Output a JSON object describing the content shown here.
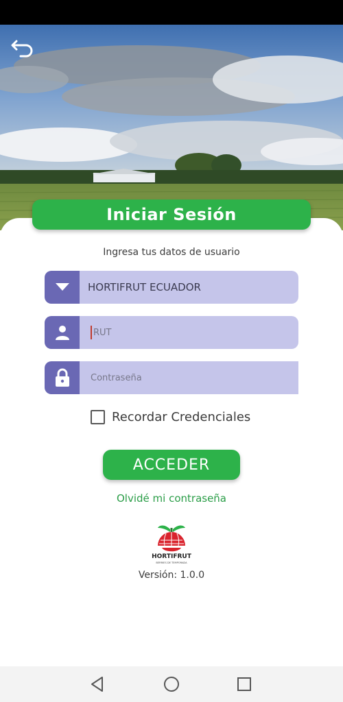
{
  "login": {
    "title": "Iniciar Sesión",
    "subtitle": "Ingresa tus datos de usuario",
    "company_select": {
      "value": "HORTIFRUT ECUADOR"
    },
    "rut_field": {
      "placeholder": "RUT"
    },
    "password_field": {
      "placeholder": "Contraseña"
    },
    "remember_label": "Recordar Credenciales",
    "remember_checked": false,
    "submit_label": "ACCEDER",
    "forgot_label": "Olvidé mi contraseña",
    "version": "Versión: 1.0.0"
  },
  "logo": {
    "text": "HORTIFRUT",
    "tagline": "BERRIES DE TEMPORADA"
  },
  "icons": {
    "back": "back-arrow-icon",
    "dropdown": "caret-down-icon",
    "user": "person-icon",
    "lock": "lock-icon",
    "nav_back": "triangle-back-icon",
    "nav_home": "circle-home-icon",
    "nav_recents": "square-recents-icon"
  },
  "colors": {
    "primary_green": "#2db24a",
    "field_bg": "#c5c5ea",
    "icon_box": "#6a68b4",
    "link_green": "#2a9d47"
  }
}
